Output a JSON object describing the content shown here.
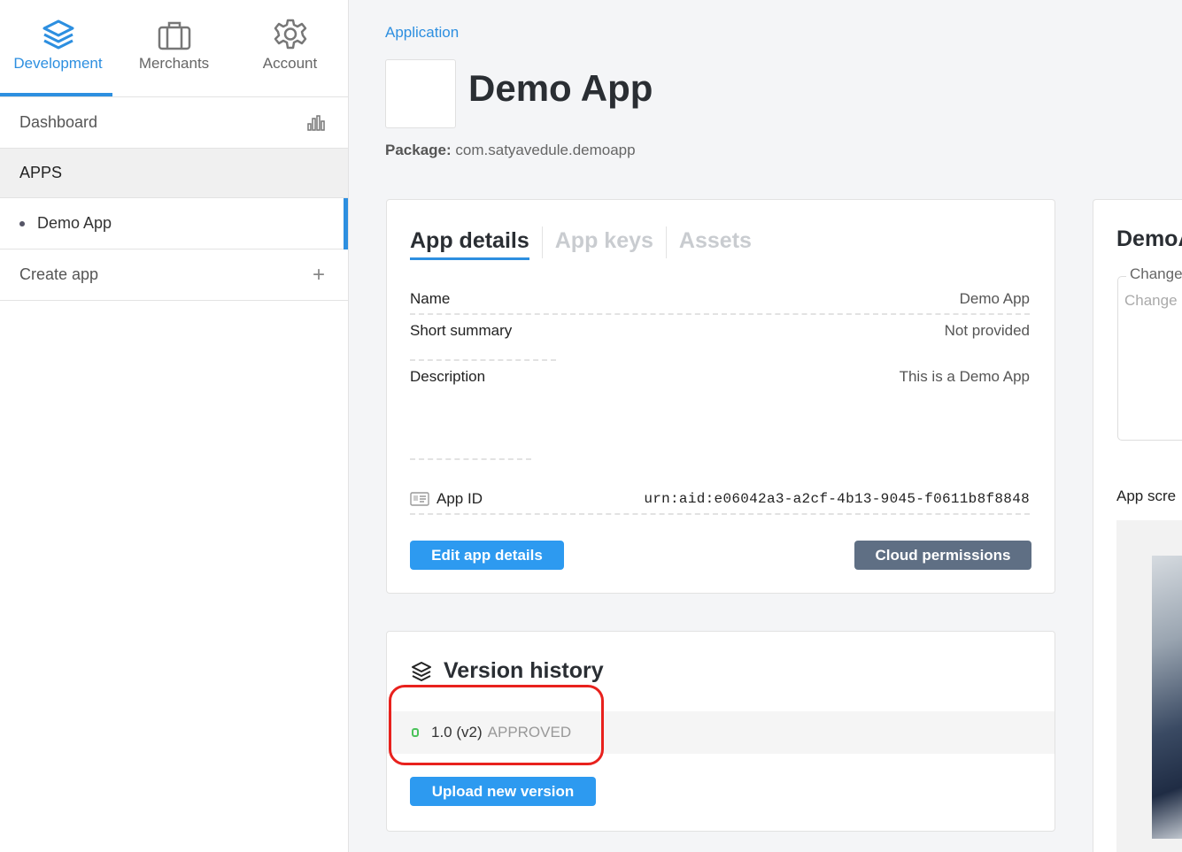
{
  "topnav": [
    {
      "label": "Development",
      "icon": "layers-icon",
      "active": true
    },
    {
      "label": "Merchants",
      "icon": "briefcase-icon",
      "active": false
    },
    {
      "label": "Account",
      "icon": "gear-icon",
      "active": false
    }
  ],
  "sidebar": {
    "dashboard": "Dashboard",
    "apps_section": "APPS",
    "app_item": "Demo App",
    "create_app": "Create app",
    "create_icon": "+"
  },
  "header": {
    "breadcrumb": "Application",
    "title": "Demo App",
    "package_label": "Package:",
    "package_value": "com.satyavedule.demoapp"
  },
  "details": {
    "tabs": [
      "App details",
      "App keys",
      "Assets"
    ],
    "fields": {
      "name_label": "Name",
      "name_value": "Demo App",
      "summary_label": "Short summary",
      "summary_value": "Not provided",
      "description_label": "Description",
      "description_value": "This is a Demo App",
      "appid_label": "App ID",
      "appid_value": "urn:aid:e06042a3-a2cf-4b13-9045-f0611b8f8848"
    },
    "edit_button": "Edit app details",
    "cloud_button": "Cloud permissions"
  },
  "version_history": {
    "title": "Version history",
    "version": "1.0 (v2)",
    "status": "APPROVED",
    "upload_button": "Upload new version"
  },
  "right_panel": {
    "title": "DemoA",
    "legend": "Change",
    "placeholder": "Change",
    "screens_label": "App scre"
  },
  "colors": {
    "accent": "#2d8fe0",
    "button_blue": "#2d9af0",
    "button_gray": "#5f6f84",
    "approved_dot": "#4cc35b",
    "highlight_red": "#e8211d"
  }
}
